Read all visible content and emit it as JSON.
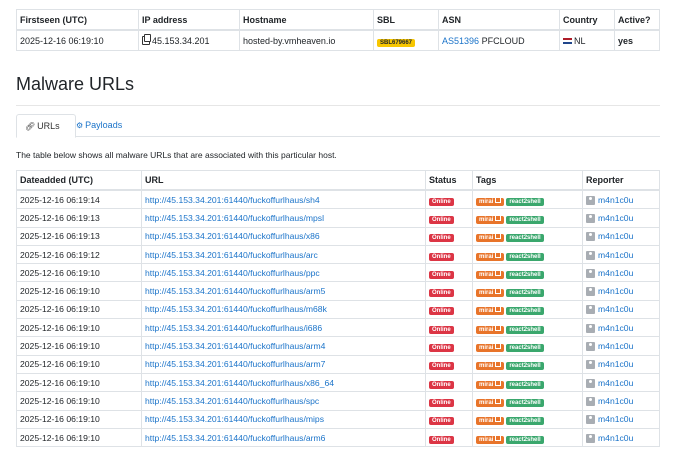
{
  "host_table": {
    "headers": [
      "Firstseen (UTC)",
      "IP address",
      "Hostname",
      "SBL",
      "ASN",
      "Country",
      "Active?"
    ],
    "row": {
      "firstseen": "2025-12-16 06:19:10",
      "ip": "45.153.34.201",
      "hostname": "hosted-by.vmheaven.io",
      "sbl": "SBL679667",
      "asn_link": "AS51396",
      "asn_name": "PFCLOUD",
      "country": "NL",
      "active": "yes"
    }
  },
  "section_title": "Malware URLs",
  "tabs": [
    {
      "label": "URLs",
      "icon": "link-icon"
    },
    {
      "label": "Payloads",
      "icon": "gear-icon"
    }
  ],
  "description": "The table below shows all malware URLs that are associated with this particular host.",
  "url_table": {
    "headers": [
      "Dateadded (UTC)",
      "URL",
      "Status",
      "Tags",
      "Reporter"
    ],
    "rows": [
      {
        "date": "2025-12-16 06:19:14",
        "url": "http://45.153.34.201:61440/fuckoffurlhaus/sh4",
        "status": "Online",
        "tag1": "mirai",
        "tag2": "react2shell",
        "reporter": "m4n1c0u"
      },
      {
        "date": "2025-12-16 06:19:13",
        "url": "http://45.153.34.201:61440/fuckoffurlhaus/mpsl",
        "status": "Online",
        "tag1": "mirai",
        "tag2": "react2shell",
        "reporter": "m4n1c0u"
      },
      {
        "date": "2025-12-16 06:19:13",
        "url": "http://45.153.34.201:61440/fuckoffurlhaus/x86",
        "status": "Online",
        "tag1": "mirai",
        "tag2": "react2shell",
        "reporter": "m4n1c0u"
      },
      {
        "date": "2025-12-16 06:19:12",
        "url": "http://45.153.34.201:61440/fuckoffurlhaus/arc",
        "status": "Online",
        "tag1": "mirai",
        "tag2": "react2shell",
        "reporter": "m4n1c0u"
      },
      {
        "date": "2025-12-16 06:19:10",
        "url": "http://45.153.34.201:61440/fuckoffurlhaus/ppc",
        "status": "Online",
        "tag1": "mirai",
        "tag2": "react2shell",
        "reporter": "m4n1c0u"
      },
      {
        "date": "2025-12-16 06:19:10",
        "url": "http://45.153.34.201:61440/fuckoffurlhaus/arm5",
        "status": "Online",
        "tag1": "mirai",
        "tag2": "react2shell",
        "reporter": "m4n1c0u"
      },
      {
        "date": "2025-12-16 06:19:10",
        "url": "http://45.153.34.201:61440/fuckoffurlhaus/m68k",
        "status": "Online",
        "tag1": "mirai",
        "tag2": "react2shell",
        "reporter": "m4n1c0u"
      },
      {
        "date": "2025-12-16 06:19:10",
        "url": "http://45.153.34.201:61440/fuckoffurlhaus/i686",
        "status": "Online",
        "tag1": "mirai",
        "tag2": "react2shell",
        "reporter": "m4n1c0u"
      },
      {
        "date": "2025-12-16 06:19:10",
        "url": "http://45.153.34.201:61440/fuckoffurlhaus/arm4",
        "status": "Online",
        "tag1": "mirai",
        "tag2": "react2shell",
        "reporter": "m4n1c0u"
      },
      {
        "date": "2025-12-16 06:19:10",
        "url": "http://45.153.34.201:61440/fuckoffurlhaus/arm7",
        "status": "Online",
        "tag1": "mirai",
        "tag2": "react2shell",
        "reporter": "m4n1c0u"
      },
      {
        "date": "2025-12-16 06:19:10",
        "url": "http://45.153.34.201:61440/fuckoffurlhaus/x86_64",
        "status": "Online",
        "tag1": "mirai",
        "tag2": "react2shell",
        "reporter": "m4n1c0u"
      },
      {
        "date": "2025-12-16 06:19:10",
        "url": "http://45.153.34.201:61440/fuckoffurlhaus/spc",
        "status": "Online",
        "tag1": "mirai",
        "tag2": "react2shell",
        "reporter": "m4n1c0u"
      },
      {
        "date": "2025-12-16 06:19:10",
        "url": "http://45.153.34.201:61440/fuckoffurlhaus/mips",
        "status": "Online",
        "tag1": "mirai",
        "tag2": "react2shell",
        "reporter": "m4n1c0u"
      },
      {
        "date": "2025-12-16 06:19:10",
        "url": "http://45.153.34.201:61440/fuckoffurlhaus/arm6",
        "status": "Online",
        "tag1": "mirai",
        "tag2": "react2shell",
        "reporter": "m4n1c0u"
      }
    ]
  },
  "colors": {
    "link": "#1a73c9",
    "status_online": "#dc3545",
    "tag_mirai": "#e8742a",
    "tag_react": "#3aa76d",
    "sbl_badge": "#f7c600"
  }
}
